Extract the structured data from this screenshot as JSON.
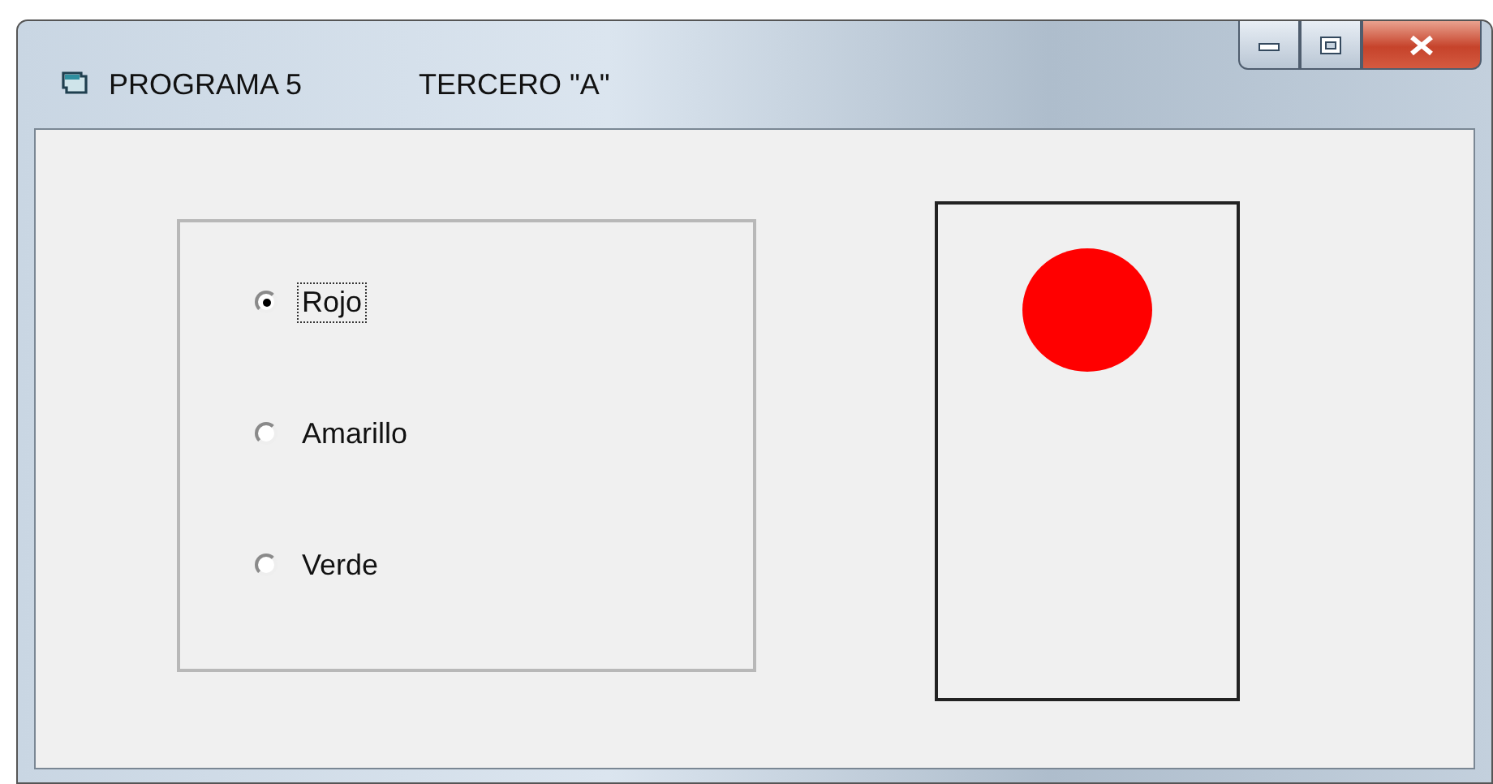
{
  "window": {
    "title": "PROGRAMA 5",
    "subtitle": "TERCERO \"A\""
  },
  "options": [
    {
      "label": "Rojo",
      "selected": true
    },
    {
      "label": "Amarillo",
      "selected": false
    },
    {
      "label": "Verde",
      "selected": false
    }
  ],
  "light": {
    "color": "#ff0000"
  }
}
